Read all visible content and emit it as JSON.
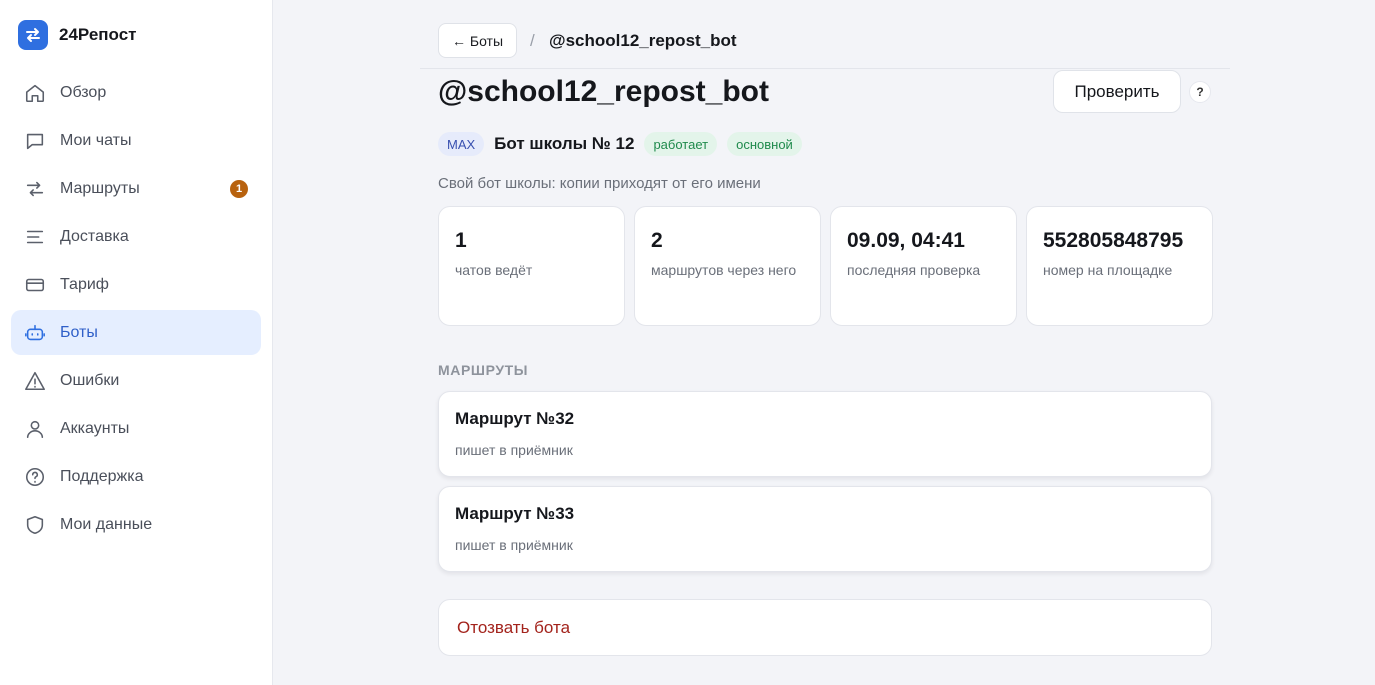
{
  "brand": {
    "name": "24Репост",
    "logo_icon": "swap-arrows-icon",
    "logo_color": "#2f6fe0"
  },
  "sidebar": {
    "items": [
      {
        "label": "Обзор",
        "icon": "home-icon",
        "active": false
      },
      {
        "label": "Мои чаты",
        "icon": "chat-icon",
        "active": false
      },
      {
        "label": "Маршруты",
        "icon": "routes-icon",
        "active": false,
        "badge": "1"
      },
      {
        "label": "Доставка",
        "icon": "lines-icon",
        "active": false
      },
      {
        "label": "Тариф",
        "icon": "card-icon",
        "active": false
      },
      {
        "label": "Боты",
        "icon": "bot-icon",
        "active": true
      },
      {
        "label": "Ошибки",
        "icon": "warning-icon",
        "active": false
      },
      {
        "label": "Аккаунты",
        "icon": "user-icon",
        "active": false
      },
      {
        "label": "Поддержка",
        "icon": "help-circle-icon",
        "active": false
      },
      {
        "label": "Мои данные",
        "icon": "shield-icon",
        "active": false
      }
    ]
  },
  "header": {
    "back_label": "← Боты",
    "separator": "/",
    "current": "@school12_repost_bot"
  },
  "page": {
    "title": "@school12_repost_bot",
    "check_label": "Проверить",
    "help_label": "?",
    "platform": "MAX",
    "bot_name": "Бот школы № 12",
    "status": "работает",
    "role": "основной",
    "subtitle": "Свой бот школы: копии приходят от его имени"
  },
  "stats": [
    {
      "value": "1",
      "label": "чатов ведёт"
    },
    {
      "value": "2",
      "label": "маршрутов через него"
    },
    {
      "value": "09.09, 04:41",
      "label": "последняя проверка"
    },
    {
      "value": "552805848795",
      "label": "номер на площадке"
    }
  ],
  "routes": {
    "section_title": "МАРШРУТЫ",
    "items": [
      {
        "title": "Маршрут №32",
        "subtitle": "пишет в приёмник"
      },
      {
        "title": "Маршрут №33",
        "subtitle": "пишет в приёмник"
      }
    ]
  },
  "revoke": {
    "label": "Отозвать бота"
  },
  "colors": {
    "accent": "#2f6fe0",
    "danger": "#a3231c",
    "success": "#1f8a4c",
    "badge": "#b8620e"
  }
}
